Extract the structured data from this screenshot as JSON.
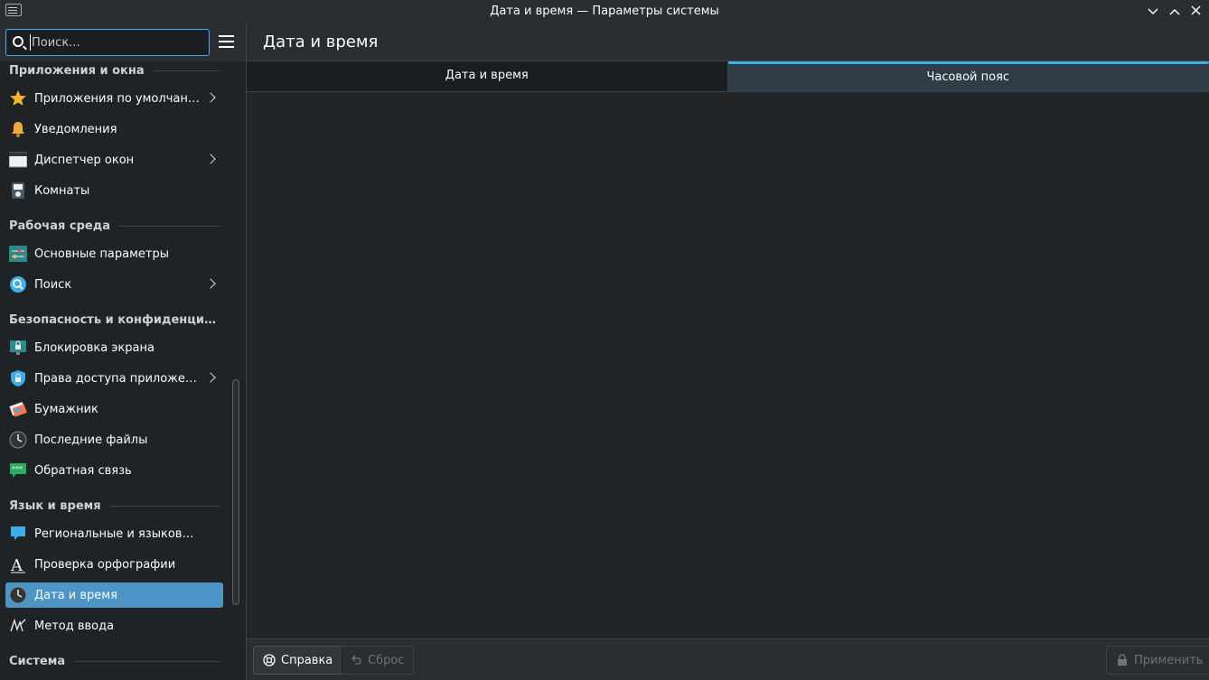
{
  "window": {
    "title": "Дата и время — Параметры системы"
  },
  "search": {
    "placeholder": "Поиск..."
  },
  "sidebar": {
    "sections": [
      {
        "label": "Приложения и окна"
      },
      {
        "label": "Рабочая среда"
      },
      {
        "label": "Безопасность и конфиденциальность"
      },
      {
        "label": "Язык и время"
      },
      {
        "label": "Система"
      }
    ],
    "items": [
      {
        "label": "Приложения по умолчанию",
        "icon": "star-icon",
        "has_children": true
      },
      {
        "label": "Уведомления",
        "icon": "bell-icon",
        "has_children": false
      },
      {
        "label": "Диспетчер окон",
        "icon": "window-icon",
        "has_children": true
      },
      {
        "label": "Комнаты",
        "icon": "activities-icon",
        "has_children": false
      },
      {
        "label": "Основные параметры",
        "icon": "settings-sliders-icon",
        "has_children": false
      },
      {
        "label": "Поиск",
        "icon": "search-globe-icon",
        "has_children": true
      },
      {
        "label": "Блокировка экрана",
        "icon": "lock-screen-icon",
        "has_children": false
      },
      {
        "label": "Права доступа приложений",
        "icon": "shield-lock-icon",
        "has_children": true
      },
      {
        "label": "Бумажник",
        "icon": "wallet-icon",
        "has_children": false
      },
      {
        "label": "Последние файлы",
        "icon": "clock-history-icon",
        "has_children": false
      },
      {
        "label": "Обратная связь",
        "icon": "feedback-icon",
        "has_children": false
      },
      {
        "label": "Региональные и языковые параметры",
        "icon": "region-flag-icon",
        "has_children": false
      },
      {
        "label": "Проверка орфографии",
        "icon": "spellcheck-icon",
        "has_children": false
      },
      {
        "label": "Дата и время",
        "icon": "clock-icon",
        "has_children": false,
        "active": true
      },
      {
        "label": "Метод ввода",
        "icon": "input-method-icon",
        "has_children": false
      }
    ]
  },
  "main": {
    "title": "Дата и время",
    "tabs": [
      {
        "label": "Дата и время",
        "selected": false
      },
      {
        "label": "Часовой пояс",
        "selected": true
      }
    ]
  },
  "footer": {
    "help_label": "Справка",
    "reset_label": "Сброс",
    "apply_label": "Применить"
  },
  "colors": {
    "accent": "#3daee9",
    "active_item": "#4d95c7",
    "background": "#232629"
  }
}
